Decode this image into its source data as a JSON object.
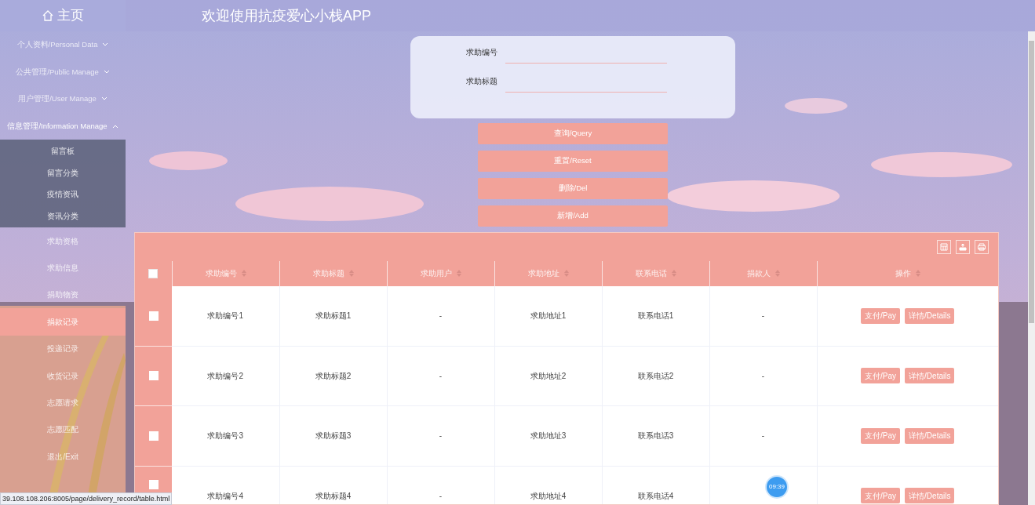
{
  "header": {
    "home": "主页",
    "title": "欢迎使用抗疫爱心小栈APP"
  },
  "sidebar": {
    "items": [
      {
        "kind": "group",
        "label": "个人资料/Personal Data",
        "expanded": false,
        "selected": false
      },
      {
        "kind": "group",
        "label": "公共管理/Public Manage",
        "expanded": false,
        "selected": false
      },
      {
        "kind": "group",
        "label": "用户管理/User Manage",
        "expanded": false,
        "selected": false
      },
      {
        "kind": "group",
        "label": "信息管理/Information Manage",
        "expanded": true,
        "selected": false,
        "children": [
          {
            "label": "留言板",
            "selected": false
          },
          {
            "label": "留言分类",
            "selected": false
          },
          {
            "label": "疫情资讯",
            "selected": false
          },
          {
            "label": "资讯分类",
            "selected": false
          }
        ]
      },
      {
        "kind": "link",
        "label": "求助资格",
        "selected": false
      },
      {
        "kind": "link",
        "label": "求助信息",
        "selected": false
      },
      {
        "kind": "link",
        "label": "捐助物资",
        "selected": false
      },
      {
        "kind": "link",
        "label": "捐款记录",
        "selected": true
      },
      {
        "kind": "link",
        "label": "投递记录",
        "selected": false
      },
      {
        "kind": "link",
        "label": "收货记录",
        "selected": false
      },
      {
        "kind": "link",
        "label": "志愿请求",
        "selected": false
      },
      {
        "kind": "link",
        "label": "志愿匹配",
        "selected": false
      },
      {
        "kind": "link",
        "label": "退出/Exit",
        "selected": false
      }
    ]
  },
  "search": {
    "fields": [
      {
        "label": "求助编号"
      },
      {
        "label": "求助标题"
      }
    ],
    "buttons": [
      "查询/Query",
      "重置/Reset",
      "删除/Del",
      "新增/Add"
    ]
  },
  "table": {
    "select_all": {
      "checked": false
    },
    "columns": [
      "求助编号",
      "求助标题",
      "求助用户",
      "求助地址",
      "联系电话",
      "捐款人",
      "操作"
    ],
    "rows": [
      {
        "checked": false,
        "cells": [
          "求助编号1",
          "求助标题1",
          "-",
          "求助地址1",
          "联系电话1",
          "-"
        ],
        "actions": [
          "支付/Pay",
          "详情/Details"
        ]
      },
      {
        "checked": false,
        "cells": [
          "求助编号2",
          "求助标题2",
          "-",
          "求助地址2",
          "联系电话2",
          "-"
        ],
        "actions": [
          "支付/Pay",
          "详情/Details"
        ]
      },
      {
        "checked": false,
        "cells": [
          "求助编号3",
          "求助标题3",
          "-",
          "求助地址3",
          "联系电话3",
          "-"
        ],
        "actions": [
          "支付/Pay",
          "详情/Details"
        ]
      },
      {
        "checked": false,
        "cells": [
          "求助编号4",
          "求助标题4",
          "-",
          "求助地址4",
          "联系电话4",
          ""
        ],
        "actions": [
          "支付/Pay",
          "详情/Details"
        ]
      }
    ]
  },
  "timer": "09:39",
  "status_url": "39.108.108.206:8005/page/delivery_record/table.html"
}
